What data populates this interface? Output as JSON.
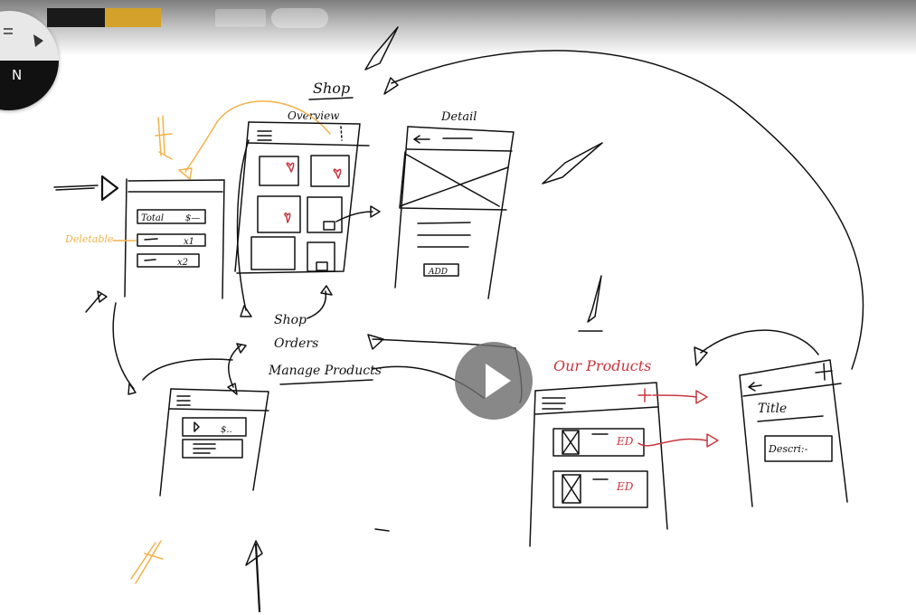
{
  "player": {
    "play_icon": "play-icon",
    "menu_icon": "hamburger-icon",
    "brush_icon": "brush-icon",
    "pen_glyph": "N",
    "colors": {
      "progress_played": "#1a1a1a",
      "progress_buffered": "#d4a22a",
      "play_overlay": "#6e6e6e"
    }
  },
  "sketch": {
    "shop_title": "Shop",
    "overview_label": "Overview",
    "detail_label": "Detail",
    "cart": {
      "total_label": "Total",
      "total_value": "$—",
      "qty_1": "x1",
      "qty_2": "x2"
    },
    "deletable_label": "Deletable",
    "detail_add_button": "ADD",
    "menu": {
      "shop": "Shop",
      "orders": "Orders",
      "manage_products": "Manage Products"
    },
    "orders_row_value": "$..",
    "our_products_title": "Our Products",
    "admin_rows": [
      "ED",
      "ED"
    ],
    "form": {
      "title_label": "Title",
      "description_label": "Descri:-"
    },
    "ink_colors": {
      "black": "#111111",
      "orange": "#f2b24c",
      "red": "#c8363f"
    }
  }
}
